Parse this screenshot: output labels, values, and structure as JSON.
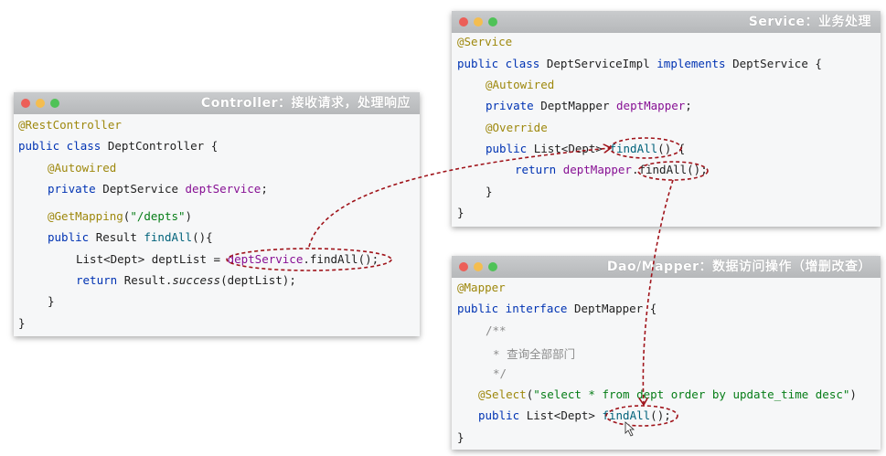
{
  "controller": {
    "title": "Controller：接收请求，处理响应",
    "lines": {
      "l1": "@RestController",
      "l2a": "public class ",
      "l2b": "DeptController {",
      "l3": "@Autowired",
      "l4a": "private ",
      "l4b": "DeptService ",
      "l4c": "deptService",
      "l4d": ";",
      "l5a": "@GetMapping",
      "l5b": "(",
      "l5c": "\"/depts\"",
      "l5d": ")",
      "l6a": "public ",
      "l6b": "Result ",
      "l6c": "findAll",
      "l6d": "(){",
      "l7a": "List<Dept> deptList = ",
      "l7b": "deptService",
      "l7c": ".findAll();",
      "l8a": "return ",
      "l8b": "Result.",
      "l8c": "success",
      "l8d": "(deptList);",
      "l9": "}",
      "l10": "}"
    }
  },
  "service": {
    "title": "Service：业务处理",
    "lines": {
      "l1": "@Service",
      "l2a": "public class ",
      "l2b": "DeptServiceImpl ",
      "l2c": "implements ",
      "l2d": "DeptService {",
      "l3": "@Autowired",
      "l4a": "private ",
      "l4b": "DeptMapper ",
      "l4c": "deptMapper",
      "l4d": ";",
      "l5": "@Override",
      "l6a": "public ",
      "l6b": "List<Dept> ",
      "l6c": "findAll",
      "l6d": "() {",
      "l7a": "return ",
      "l7b": "deptMapper",
      "l7c": ".findAll();",
      "l8": "}",
      "l9": "}"
    }
  },
  "mapper": {
    "title": "Dao/Mapper：数据访问操作（增删改查）",
    "lines": {
      "l1": "@Mapper",
      "l2a": "public interface ",
      "l2b": "DeptMapper {",
      "l3": "/**",
      "l4a": "* ",
      "l4b": "查询全部部门",
      "l5": "*/",
      "l6a": "@Select",
      "l6b": "(",
      "l6c": "\"select * from dept order by update_time desc\"",
      "l6d": ")",
      "l7a": "public ",
      "l7b": "List<Dept> ",
      "l7c": "findAll",
      "l7d": "();",
      "l8": "}"
    }
  },
  "colors": {
    "arrow": "#a0141b",
    "annotation": "#9e880d",
    "keyword": "#0033b3",
    "field": "#871094"
  }
}
